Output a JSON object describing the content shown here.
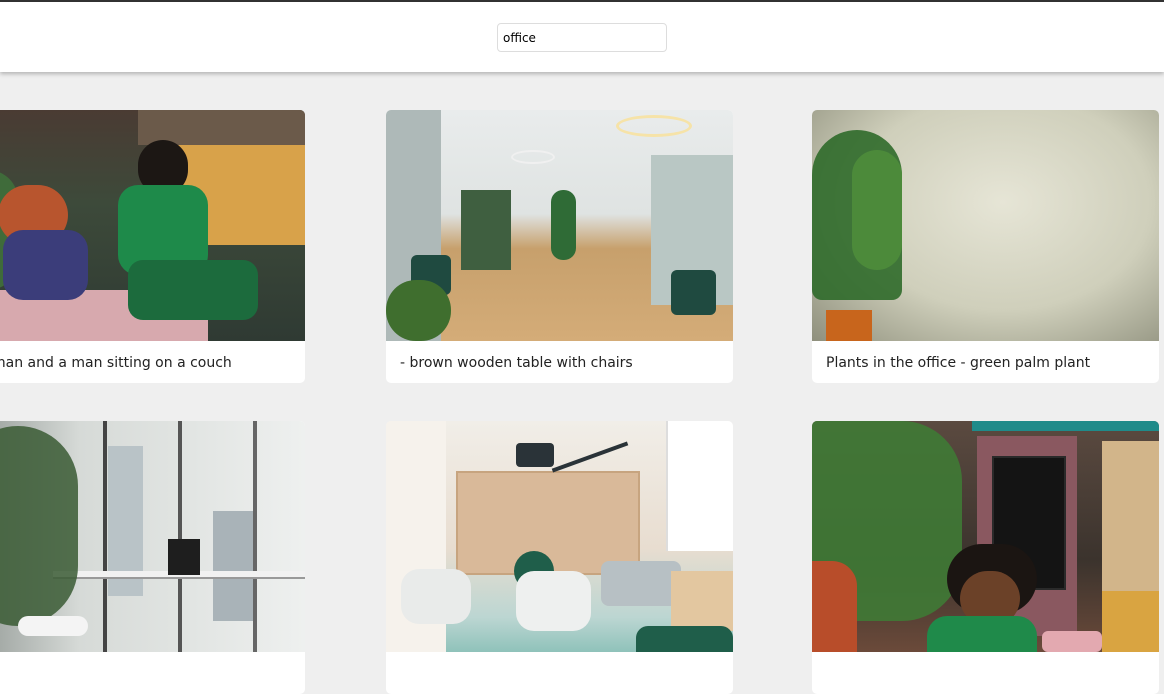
{
  "search": {
    "value": "office",
    "placeholder": ""
  },
  "cards": [
    {
      "caption": "woman and a man sitting on a couch",
      "image": "two-women-on-couch-image"
    },
    {
      "caption": "- brown wooden table with chairs",
      "image": "open-office-lounge-image"
    },
    {
      "caption": "Plants in the office - green palm plant",
      "image": "palm-plant-image"
    },
    {
      "caption": "",
      "image": "window-desk-plants-image"
    },
    {
      "caption": "",
      "image": "lounge-chairs-lamp-image"
    },
    {
      "caption": "",
      "image": "woman-laughing-kitchen-image"
    }
  ]
}
